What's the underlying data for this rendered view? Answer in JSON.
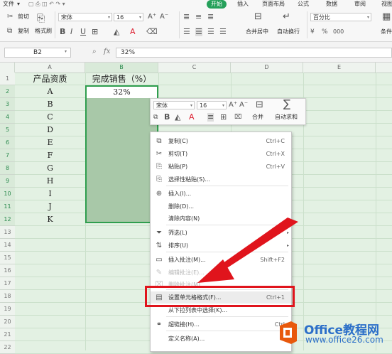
{
  "menubar": {
    "file": "文件",
    "start": "开始",
    "insert": "插入",
    "page_layout": "页面布局",
    "formula": "公式",
    "data": "数据",
    "review": "审阅",
    "view": "视图"
  },
  "ribbon": {
    "cut": "剪切",
    "copy": "复制",
    "format_painter": "格式刷",
    "font_name": "宋体",
    "font_size": "16",
    "merge_center": "合并居中",
    "wrap_text": "自动换行",
    "number_format": "百分比",
    "conditional": "条件"
  },
  "formula_bar": {
    "cell_ref": "B2",
    "fx": "fx",
    "value": "32%"
  },
  "columns": [
    "A",
    "B",
    "C",
    "D",
    "E"
  ],
  "rows": [
    "1",
    "2",
    "3",
    "4",
    "5",
    "6",
    "7",
    "8",
    "9",
    "10",
    "11",
    "12",
    "13",
    "14",
    "15",
    "16",
    "17",
    "18",
    "19",
    "20",
    "21",
    "22"
  ],
  "sheet": {
    "header_a": "产品资质",
    "header_b": "完成销售（%）",
    "b2": "32%",
    "products": [
      "A",
      "B",
      "C",
      "D",
      "E",
      "F",
      "G",
      "H",
      "I",
      "J",
      "K"
    ]
  },
  "mini_toolbar": {
    "font_name": "宋体",
    "font_size": "16",
    "merge": "合并",
    "autosum": "自动求和"
  },
  "context_menu": [
    {
      "label": "复制(C)",
      "shortcut": "Ctrl+C",
      "icon": "copy-icon",
      "disabled": false
    },
    {
      "label": "剪切(T)",
      "shortcut": "Ctrl+X",
      "icon": "scissors-icon",
      "disabled": false
    },
    {
      "label": "粘贴(P)",
      "shortcut": "Ctrl+V",
      "icon": "paste-icon",
      "disabled": false
    },
    {
      "label": "选择性粘贴(S)...",
      "shortcut": "",
      "icon": "paste-special-icon",
      "disabled": false
    },
    {
      "label": "插入(I)...",
      "shortcut": "",
      "icon": "insert-icon",
      "disabled": false
    },
    {
      "label": "删除(D)...",
      "shortcut": "",
      "icon": "",
      "disabled": false
    },
    {
      "label": "清除内容(N)",
      "shortcut": "",
      "icon": "",
      "disabled": false
    },
    {
      "label": "筛选(L)",
      "shortcut": "",
      "icon": "filter-icon",
      "disabled": false
    },
    {
      "label": "排序(U)",
      "shortcut": "",
      "icon": "sort-icon",
      "disabled": false
    },
    {
      "label": "插入批注(M)...",
      "shortcut": "Shift+F2",
      "icon": "comment-icon",
      "disabled": false
    },
    {
      "label": "编辑批注(E)...",
      "shortcut": "",
      "icon": "edit-comment-icon",
      "disabled": true
    },
    {
      "label": "删除批注(M)",
      "shortcut": "",
      "icon": "delete-comment-icon",
      "disabled": true
    },
    {
      "label": "设置单元格格式(F)...",
      "shortcut": "Ctrl+1",
      "icon": "format-cells-icon",
      "disabled": false
    },
    {
      "label": "从下拉列表中选择(K)...",
      "shortcut": "",
      "icon": "",
      "disabled": false
    },
    {
      "label": "超链接(H)...",
      "shortcut": "Ctrl",
      "icon": "link-icon",
      "disabled": false
    },
    {
      "label": "定义名称(A)...",
      "shortcut": "",
      "icon": "",
      "disabled": false
    }
  ],
  "watermark": {
    "brand": "Office教程网",
    "url": "www.office26.com"
  },
  "colors": {
    "accent": "#25a05a",
    "highlight": "#e0141c",
    "selection_border": "#2f9e4e"
  }
}
